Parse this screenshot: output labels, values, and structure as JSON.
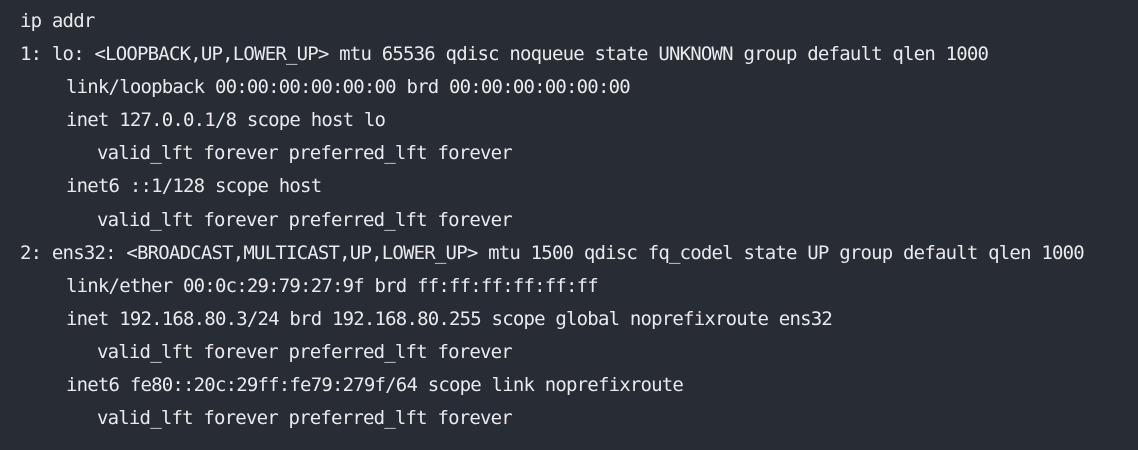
{
  "terminal": {
    "background": "#282c34",
    "foreground": "#e8eaed",
    "command": "ip addr",
    "lines": [
      "1: lo: <LOOPBACK,UP,LOWER_UP> mtu 65536 qdisc noqueue state UNKNOWN group default qlen 1000",
      "link/loopback 00:00:00:00:00:00 brd 00:00:00:00:00:00",
      "inet 127.0.0.1/8 scope host lo",
      "valid_lft forever preferred_lft forever",
      "inet6 ::1/128 scope host",
      "valid_lft forever preferred_lft forever",
      "2: ens32: <BROADCAST,MULTICAST,UP,LOWER_UP> mtu 1500 qdisc fq_codel state UP group default qlen 1000",
      "link/ether 00:0c:29:79:27:9f brd ff:ff:ff:ff:ff:ff",
      "inet 192.168.80.3/24 brd 192.168.80.255 scope global noprefixroute ens32",
      "valid_lft forever preferred_lft forever",
      "inet6 fe80::20c:29ff:fe79:279f/64 scope link noprefixroute",
      "valid_lft forever preferred_lft forever"
    ]
  }
}
